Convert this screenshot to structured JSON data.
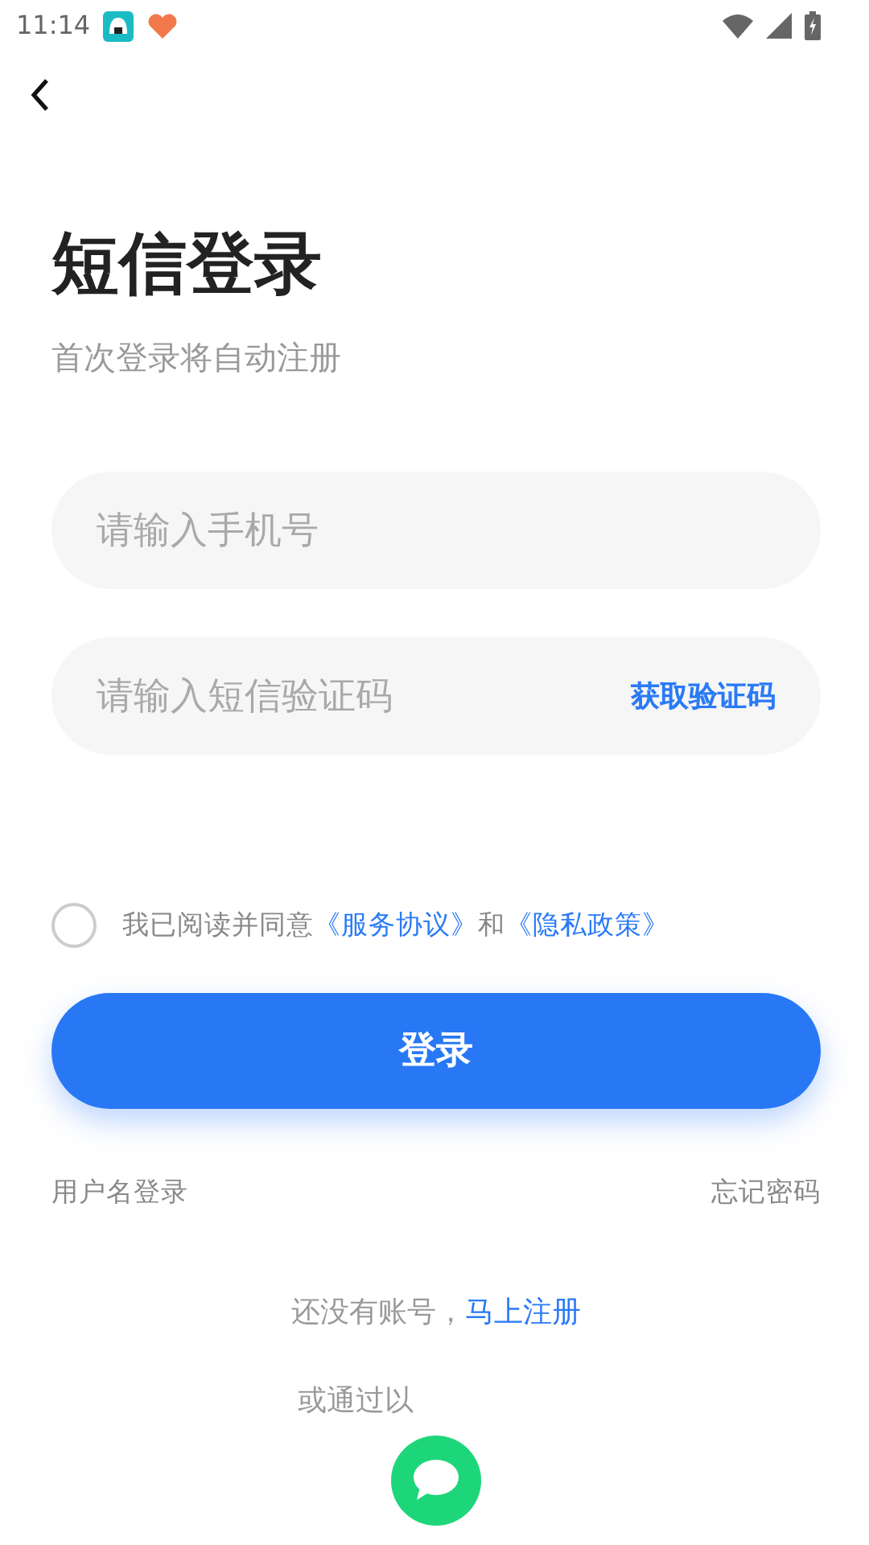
{
  "status_bar": {
    "time": "11:14"
  },
  "title": "短信登录",
  "subtitle": "首次登录将自动注册",
  "phone_field": {
    "placeholder": "请输入手机号"
  },
  "code_field": {
    "placeholder": "请输入短信验证码",
    "action": "获取验证码"
  },
  "agreement": {
    "checked": false,
    "text": "我已阅读并同意",
    "link1": "《服务协议》",
    "joiner": "和",
    "link2": "《隐私政策》"
  },
  "login_button": "登录",
  "links": {
    "left": "用户名登录",
    "right": "忘记密码"
  },
  "register": {
    "text": "还没有账号，",
    "link": "马上注册"
  },
  "other_login": {
    "text": "或通过以"
  }
}
